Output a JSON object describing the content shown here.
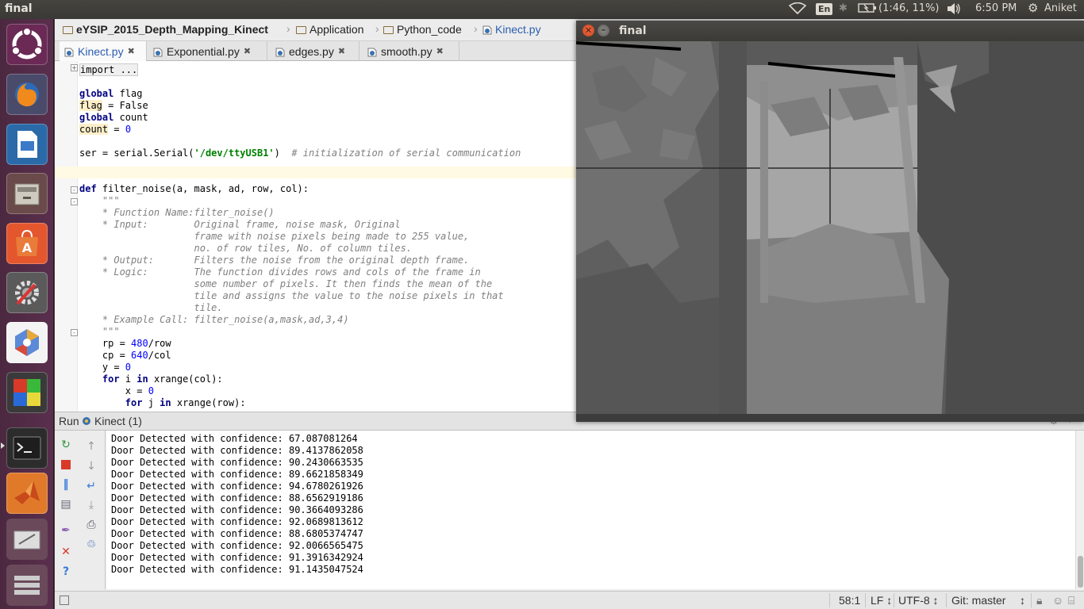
{
  "top_panel": {
    "window_title": "final",
    "lang": "En",
    "battery": "(1:46, 11%)",
    "time": "6:50 PM",
    "user": "Aniket"
  },
  "launcher": {
    "items": [
      "ubuntu-dash",
      "firefox",
      "libreoffice-impress",
      "files",
      "software-center",
      "system-settings",
      "unity-tweak",
      "cube-app",
      "terminal",
      "matlab",
      "desktop-1",
      "desktop-2",
      "workspaces"
    ]
  },
  "breadcrumbs": [
    "eYSIP_2015_Depth_Mapping_Kinect",
    "Application",
    "Python_code",
    "Kinect.py"
  ],
  "tabs": [
    {
      "label": "Kinect.py",
      "active": true
    },
    {
      "label": "Exponential.py",
      "active": false
    },
    {
      "label": "edges.py",
      "active": false
    },
    {
      "label": "smooth.py",
      "active": false
    }
  ],
  "code": {
    "l01": "import ...",
    "l03a": "global",
    "l03b": " flag",
    "l04a": "flag",
    "l04b": " = False",
    "l05a": "global",
    "l05b": " count",
    "l06a": "count",
    "l06b": " = ",
    "l06c": "0",
    "l08a": "ser = serial.Serial(",
    "l08b": "'/dev/ttyUSB1'",
    "l08c": ")  ",
    "l08d": "# initialization of serial communication",
    "l11a": "def",
    "l11b": " filter_noise(a, mask, ad, row, col):",
    "l12": "    \"\"\"",
    "l13": "    * Function Name:filter_noise()",
    "l14": "    * Input:        Original frame, noise mask, Original",
    "l15": "                    frame with noise pixels being made to 255 value,",
    "l16": "                    no. of row tiles, No. of column tiles.",
    "l17": "    * Output:       Filters the noise from the original depth frame.",
    "l18": "    * Logic:        The function divides rows and cols of the frame in",
    "l19": "                    some number of pixels. It then finds the mean of the",
    "l20": "                    tile and assigns the value to the noise pixels in that",
    "l21": "                    tile.",
    "l22": "    * Example Call: filter_noise(a,mask,ad,3,4)",
    "l23": "    \"\"\"",
    "l24a": "    rp = ",
    "l24b": "480",
    "l24c": "/row",
    "l25a": "    cp = ",
    "l25b": "640",
    "l25c": "/col",
    "l26a": "    y = ",
    "l26b": "0",
    "l27a": "    ",
    "l27b": "for",
    "l27c": " i ",
    "l27d": "in",
    "l27e": " xrange(col):",
    "l28a": "        x = ",
    "l28b": "0",
    "l29a": "        ",
    "l29b": "for",
    "l29c": " j ",
    "l29d": "in",
    "l29e": " xrange(row):"
  },
  "depth_window": {
    "title": "final"
  },
  "run_panel": {
    "label": "Run",
    "config": "Kinect (1)",
    "lines": [
      "Door Detected with confidence: 67.087081264",
      "Door Detected with confidence: 89.4137862058",
      "Door Detected with confidence: 90.2430663535",
      "Door Detected with confidence: 89.6621858349",
      "Door Detected with confidence: 94.6780261926",
      "Door Detected with confidence: 88.6562919186",
      "Door Detected with confidence: 90.3664093286",
      "Door Detected with confidence: 92.0689813612",
      "Door Detected with confidence: 88.6805374747",
      "Door Detected with confidence: 92.0066565475",
      "Door Detected with confidence: 91.3916342924",
      "Door Detected with confidence: 91.1435047524"
    ]
  },
  "status_bar": {
    "position": "58:1",
    "line_sep": "LF",
    "encoding": "UTF-8",
    "vcs": "Git: master"
  }
}
